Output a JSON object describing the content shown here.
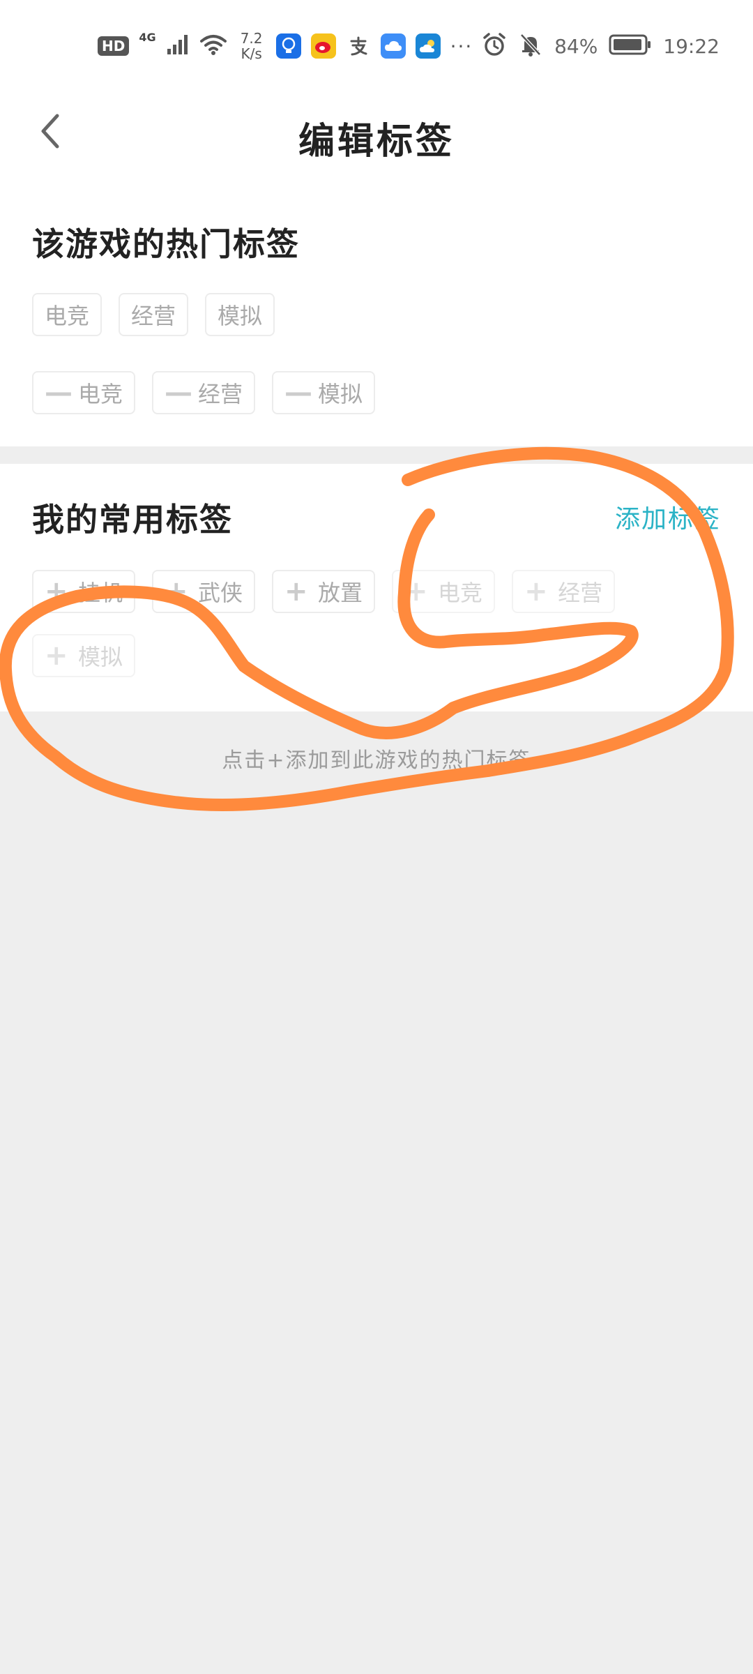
{
  "status_bar": {
    "hd": "HD",
    "network": "4G",
    "speed_value": "7.2",
    "speed_unit": "K/s",
    "battery": "84%",
    "time": "19:22",
    "more": "···"
  },
  "header": {
    "title": "编辑标签"
  },
  "hot_tags": {
    "title": "该游戏的热门标签",
    "tags": [
      "电竞",
      "经营",
      "模拟"
    ],
    "removable": [
      "电竞",
      "经营",
      "模拟"
    ]
  },
  "my_tags": {
    "title": "我的常用标签",
    "add_label": "添加标签",
    "tags": [
      "挂机",
      "武侠",
      "放置",
      "电竞",
      "经营",
      "模拟"
    ]
  },
  "hint": "点击+添加到此游戏的热门标签",
  "colors": {
    "accent": "#2bb3c6",
    "annotation": "#ff8a3d"
  }
}
